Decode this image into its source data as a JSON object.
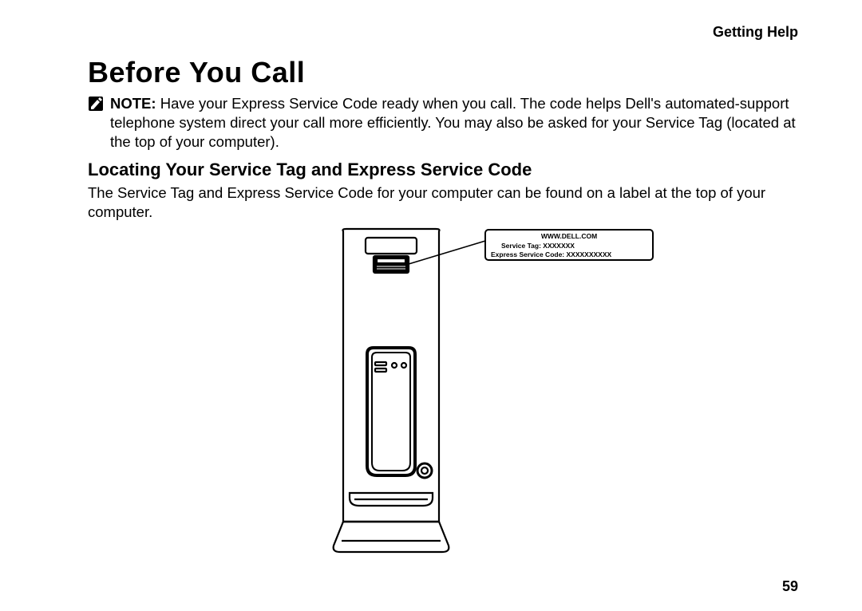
{
  "header": {
    "section_label": "Getting Help"
  },
  "title": "Before You Call",
  "note": {
    "label": "NOTE:",
    "text": "Have your Express Service Code ready when you call. The code helps Dell's automated-support telephone system direct your call more efficiently. You may also be asked for your Service Tag (located at the top of your computer)."
  },
  "subheading": "Locating Your Service Tag and Express Service Code",
  "body": "The Service Tag and Express Service Code for your computer can be found on a label at the top of your computer.",
  "callout": {
    "line1": "WWW.DELL.COM",
    "line2": "Service Tag:    XXXXXXX",
    "line3": "Express Service Code:     XXXXXXXXXX"
  },
  "page_number": "59"
}
